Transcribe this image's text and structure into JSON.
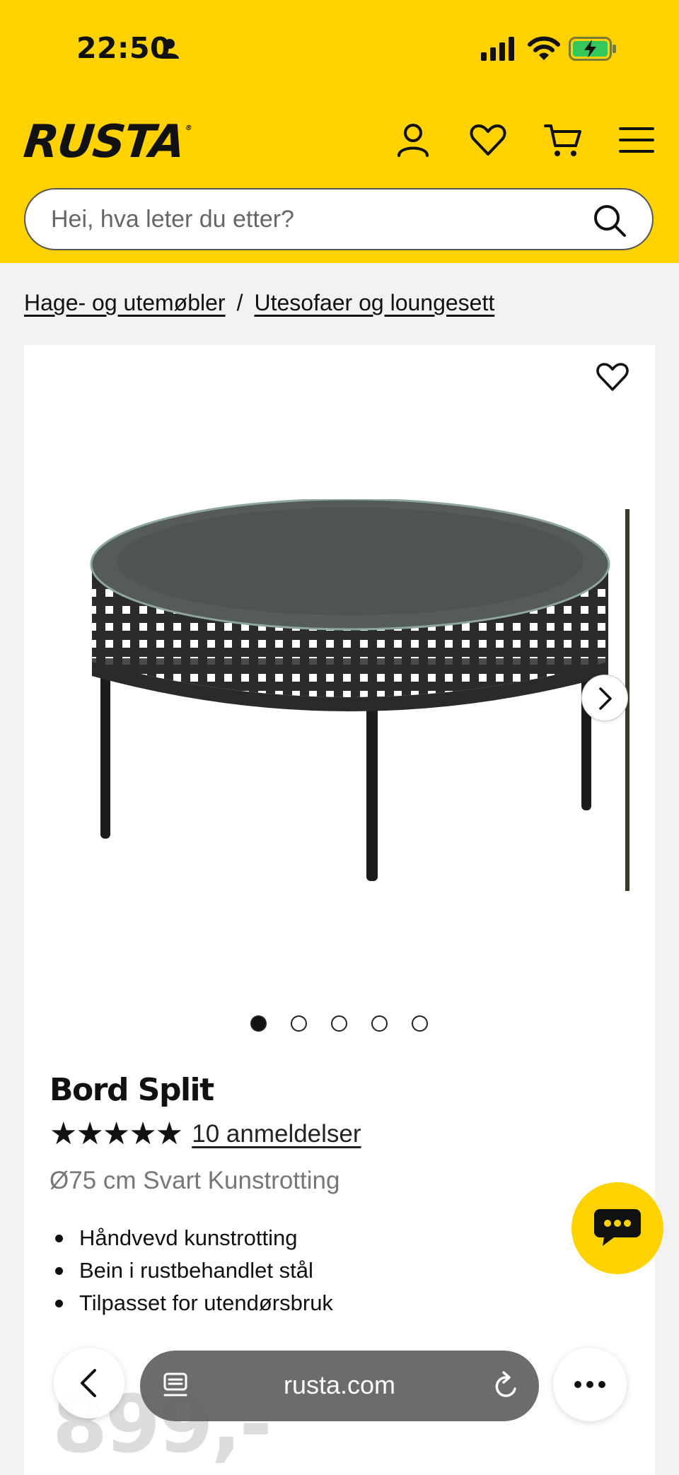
{
  "status_bar": {
    "time": "22:50"
  },
  "header": {
    "logo": "RUSTA",
    "search": {
      "placeholder": "Hei, hva leter du etter?"
    }
  },
  "breadcrumb": {
    "items": [
      "Hage- og utemøbler",
      "Utesofaer og loungesett"
    ],
    "separator": "/"
  },
  "product": {
    "title": "Bord Split",
    "rating": {
      "stars": "★★★★★",
      "value": 5,
      "max": 5,
      "reviews_label": "10 anmeldelser"
    },
    "variant": "Ø75 cm Svart Kunstrotting",
    "features": [
      "Håndvevd kunstrotting",
      "Bein i rustbehandlet stål",
      "Tilpasset for utendørsbruk"
    ],
    "price_partial": "899,-",
    "gallery": {
      "image_count": 5,
      "active_index": 0
    }
  },
  "browser": {
    "url": "rusta.com"
  },
  "colors": {
    "brand_yellow": "#ffd200",
    "text": "#111111",
    "muted": "#777777",
    "page_bg": "#f2f2f2"
  },
  "icons": {
    "header": [
      "account-icon",
      "heart-icon",
      "cart-icon",
      "menu-icon"
    ],
    "search": "search-icon",
    "chat": "chat-icon"
  }
}
